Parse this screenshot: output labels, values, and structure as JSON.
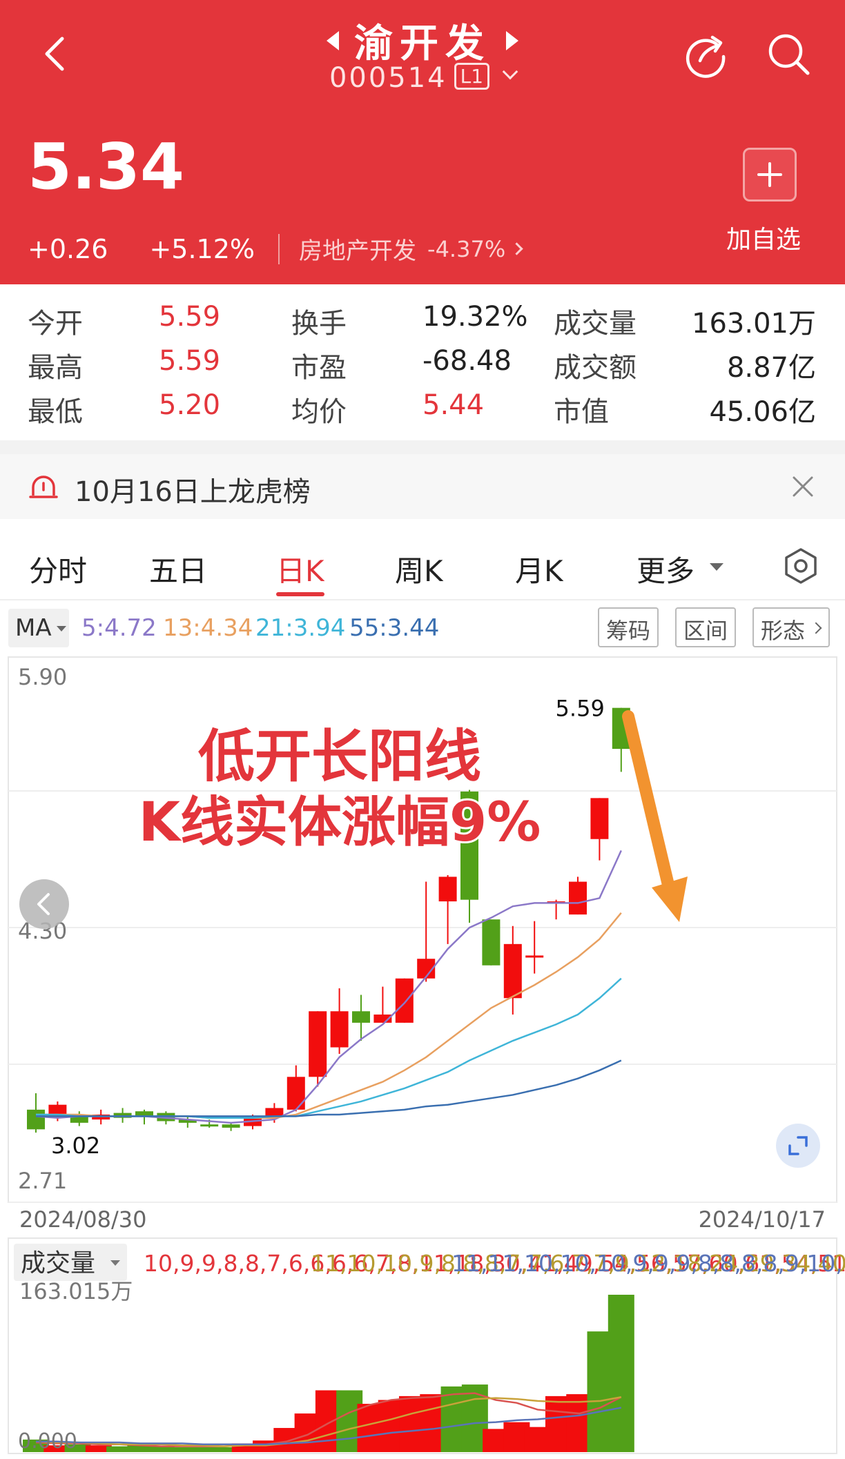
{
  "header": {
    "title": "渝开发",
    "code": "000514",
    "level_badge": "L1",
    "price": "5.34",
    "change": "+0.26",
    "change_pct": "+5.12%",
    "sector": "房地产开发",
    "sector_pct": "-4.37%",
    "add_label": "加自选"
  },
  "stats": [
    {
      "label": "今开",
      "value": "5.59"
    },
    {
      "label": "最高",
      "value": "5.59"
    },
    {
      "label": "最低",
      "value": "5.20"
    },
    {
      "label": "换手",
      "value": "19.32%"
    },
    {
      "label": "市盈",
      "value": "-68.48"
    },
    {
      "label": "均价",
      "value": "5.44"
    },
    {
      "label": "成交量",
      "value": "163.01万"
    },
    {
      "label": "成交额",
      "value": "8.87亿"
    },
    {
      "label": "市值",
      "value": "45.06亿"
    }
  ],
  "notice": {
    "text": "10月16日上龙虎榜"
  },
  "tabs": [
    "分时",
    "五日",
    "日K",
    "周K",
    "月K",
    "更多"
  ],
  "active_tab": "日K",
  "ma": {
    "selector": "MA",
    "items": [
      {
        "text": "5:4.72",
        "color": "#8b78c8"
      },
      {
        "text": "13:4.34",
        "color": "#e8a060"
      },
      {
        "text": "21:3.94",
        "color": "#3fb5d8"
      },
      {
        "text": "55:3.44",
        "color": "#3a6fb0"
      }
    ]
  },
  "tools": [
    "筹码",
    "区间",
    "形态"
  ],
  "annotation": {
    "line1": "低开长阳线",
    "line2": "K线实体涨幅9%"
  },
  "colors": {
    "up": "#f20d0d",
    "down": "#52a019",
    "accent": "#e3353b"
  },
  "chart_data": {
    "type": "candlestick",
    "y_axis_labels": [
      "5.90",
      "4.30",
      "2.71"
    ],
    "max_label": "5.59",
    "min_label": "3.02",
    "start_date": "2024/08/30",
    "end_date": "2024/10/17",
    "ylim": [
      2.71,
      5.9
    ],
    "candles": [
      {
        "o": 3.14,
        "c": 3.02,
        "h": 3.24,
        "l": 3.0
      },
      {
        "o": 3.1,
        "c": 3.17,
        "h": 3.19,
        "l": 3.07
      },
      {
        "o": 3.1,
        "c": 3.06,
        "h": 3.13,
        "l": 3.04
      },
      {
        "o": 3.08,
        "c": 3.11,
        "h": 3.14,
        "l": 3.05
      },
      {
        "o": 3.12,
        "c": 3.09,
        "h": 3.15,
        "l": 3.06
      },
      {
        "o": 3.13,
        "c": 3.1,
        "h": 3.14,
        "l": 3.05
      },
      {
        "o": 3.12,
        "c": 3.07,
        "h": 3.13,
        "l": 3.05
      },
      {
        "o": 3.08,
        "c": 3.06,
        "h": 3.1,
        "l": 3.03
      },
      {
        "o": 3.05,
        "c": 3.04,
        "h": 3.08,
        "l": 3.03
      },
      {
        "o": 3.05,
        "c": 3.03,
        "h": 3.06,
        "l": 3.01
      },
      {
        "o": 3.04,
        "c": 3.1,
        "h": 3.11,
        "l": 3.02
      },
      {
        "o": 3.1,
        "c": 3.15,
        "h": 3.18,
        "l": 3.06
      },
      {
        "o": 3.14,
        "c": 3.34,
        "h": 3.41,
        "l": 3.13
      },
      {
        "o": 3.34,
        "c": 3.74,
        "h": 3.74,
        "l": 3.28
      },
      {
        "o": 3.52,
        "c": 3.74,
        "h": 3.88,
        "l": 3.48
      },
      {
        "o": 3.74,
        "c": 3.67,
        "h": 3.84,
        "l": 3.56
      },
      {
        "o": 3.67,
        "c": 3.72,
        "h": 3.89,
        "l": 3.67
      },
      {
        "o": 3.67,
        "c": 3.94,
        "h": 3.94,
        "l": 3.67
      },
      {
        "o": 3.94,
        "c": 4.06,
        "h": 4.53,
        "l": 3.92
      },
      {
        "o": 4.41,
        "c": 4.56,
        "h": 4.57,
        "l": 4.15
      },
      {
        "o": 5.08,
        "c": 4.42,
        "h": 5.09,
        "l": 4.28
      },
      {
        "o": 4.3,
        "c": 4.02,
        "h": 4.3,
        "l": 4.02
      },
      {
        "o": 3.82,
        "c": 4.15,
        "h": 4.26,
        "l": 3.72
      },
      {
        "o": 4.08,
        "c": 4.08,
        "h": 4.29,
        "l": 3.97
      },
      {
        "o": 4.41,
        "c": 4.41,
        "h": 4.42,
        "l": 4.3
      },
      {
        "o": 4.33,
        "c": 4.53,
        "h": 4.56,
        "l": 4.33
      },
      {
        "o": 4.79,
        "c": 5.04,
        "h": 5.04,
        "l": 4.66
      },
      {
        "o": 5.59,
        "c": 5.34,
        "h": 5.59,
        "l": 5.2
      }
    ],
    "ma5": [
      3.1,
      3.09,
      3.1,
      3.1,
      3.1,
      3.1,
      3.09,
      3.08,
      3.07,
      3.06,
      3.07,
      3.08,
      3.14,
      3.29,
      3.46,
      3.57,
      3.66,
      3.79,
      3.95,
      4.12,
      4.25,
      4.31,
      4.38,
      4.4,
      4.4,
      4.4,
      4.43,
      4.72
    ],
    "ma13": [
      3.11,
      3.11,
      3.11,
      3.1,
      3.1,
      3.1,
      3.1,
      3.1,
      3.09,
      3.09,
      3.09,
      3.09,
      3.11,
      3.16,
      3.21,
      3.26,
      3.31,
      3.38,
      3.46,
      3.56,
      3.66,
      3.76,
      3.83,
      3.9,
      3.98,
      4.07,
      4.18,
      4.34
    ],
    "ma21": [
      3.11,
      3.11,
      3.1,
      3.1,
      3.1,
      3.1,
      3.1,
      3.1,
      3.09,
      3.09,
      3.09,
      3.1,
      3.1,
      3.13,
      3.16,
      3.19,
      3.23,
      3.27,
      3.32,
      3.37,
      3.44,
      3.5,
      3.56,
      3.61,
      3.66,
      3.72,
      3.82,
      3.94
    ],
    "ma55": [
      3.1,
      3.1,
      3.1,
      3.1,
      3.1,
      3.1,
      3.1,
      3.1,
      3.1,
      3.1,
      3.1,
      3.1,
      3.1,
      3.11,
      3.11,
      3.12,
      3.13,
      3.14,
      3.16,
      3.17,
      3.19,
      3.21,
      3.23,
      3.26,
      3.29,
      3.33,
      3.38,
      3.44
    ]
  },
  "volume": {
    "label": "成交量",
    "ma5": [
      10,
      9,
      9,
      8,
      8,
      7,
      6,
      6,
      6,
      6,
      7,
      8,
      11,
      18,
      30,
      41,
      49,
      54,
      56,
      57,
      60,
      61,
      54,
      51,
      44,
      42,
      40,
      46,
      57
    ],
    "ma10": [
      11,
      10,
      10,
      9,
      8,
      8,
      8,
      7,
      7,
      6,
      7,
      7,
      9,
      12,
      18,
      24,
      29,
      34,
      40,
      45,
      50,
      55,
      56,
      55,
      53,
      52,
      52,
      53,
      57
    ],
    "ma20": [
      11,
      11,
      10,
      10,
      10,
      9,
      9,
      9,
      8,
      8,
      8,
      8,
      9,
      10,
      12,
      14,
      17,
      20,
      22,
      24,
      27,
      30,
      31,
      33,
      34,
      36,
      38,
      42,
      46
    ],
    "max_label": "163.015万",
    "min_label": "0.000",
    "values": [
      13,
      7,
      8,
      7,
      6,
      7,
      6,
      5,
      5,
      5,
      9,
      12,
      25,
      40,
      64,
      64,
      50,
      54,
      58,
      60,
      68,
      70,
      24,
      31,
      26,
      58,
      60,
      125,
      163
    ]
  }
}
